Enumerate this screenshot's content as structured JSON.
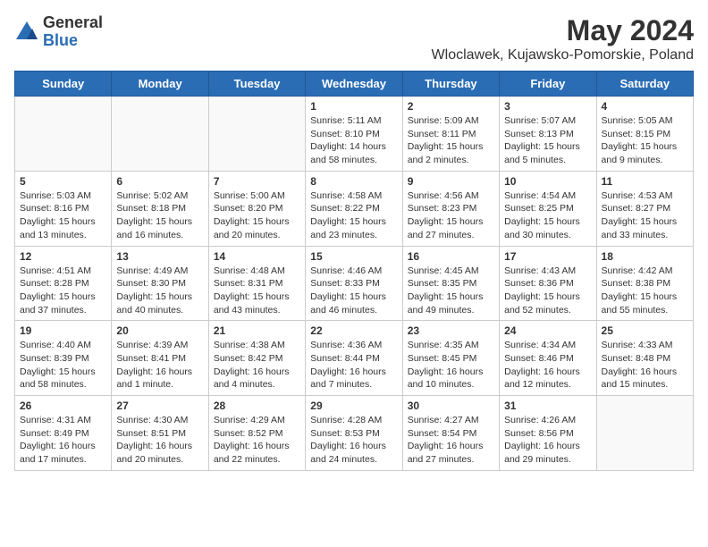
{
  "logo": {
    "general": "General",
    "blue": "Blue"
  },
  "title": "May 2024",
  "subtitle": "Wloclawek, Kujawsko-Pomorskie, Poland",
  "headers": [
    "Sunday",
    "Monday",
    "Tuesday",
    "Wednesday",
    "Thursday",
    "Friday",
    "Saturday"
  ],
  "weeks": [
    [
      {
        "day": "",
        "info": ""
      },
      {
        "day": "",
        "info": ""
      },
      {
        "day": "",
        "info": ""
      },
      {
        "day": "1",
        "info": "Sunrise: 5:11 AM\nSunset: 8:10 PM\nDaylight: 14 hours\nand 58 minutes."
      },
      {
        "day": "2",
        "info": "Sunrise: 5:09 AM\nSunset: 8:11 PM\nDaylight: 15 hours\nand 2 minutes."
      },
      {
        "day": "3",
        "info": "Sunrise: 5:07 AM\nSunset: 8:13 PM\nDaylight: 15 hours\nand 5 minutes."
      },
      {
        "day": "4",
        "info": "Sunrise: 5:05 AM\nSunset: 8:15 PM\nDaylight: 15 hours\nand 9 minutes."
      }
    ],
    [
      {
        "day": "5",
        "info": "Sunrise: 5:03 AM\nSunset: 8:16 PM\nDaylight: 15 hours\nand 13 minutes."
      },
      {
        "day": "6",
        "info": "Sunrise: 5:02 AM\nSunset: 8:18 PM\nDaylight: 15 hours\nand 16 minutes."
      },
      {
        "day": "7",
        "info": "Sunrise: 5:00 AM\nSunset: 8:20 PM\nDaylight: 15 hours\nand 20 minutes."
      },
      {
        "day": "8",
        "info": "Sunrise: 4:58 AM\nSunset: 8:22 PM\nDaylight: 15 hours\nand 23 minutes."
      },
      {
        "day": "9",
        "info": "Sunrise: 4:56 AM\nSunset: 8:23 PM\nDaylight: 15 hours\nand 27 minutes."
      },
      {
        "day": "10",
        "info": "Sunrise: 4:54 AM\nSunset: 8:25 PM\nDaylight: 15 hours\nand 30 minutes."
      },
      {
        "day": "11",
        "info": "Sunrise: 4:53 AM\nSunset: 8:27 PM\nDaylight: 15 hours\nand 33 minutes."
      }
    ],
    [
      {
        "day": "12",
        "info": "Sunrise: 4:51 AM\nSunset: 8:28 PM\nDaylight: 15 hours\nand 37 minutes."
      },
      {
        "day": "13",
        "info": "Sunrise: 4:49 AM\nSunset: 8:30 PM\nDaylight: 15 hours\nand 40 minutes."
      },
      {
        "day": "14",
        "info": "Sunrise: 4:48 AM\nSunset: 8:31 PM\nDaylight: 15 hours\nand 43 minutes."
      },
      {
        "day": "15",
        "info": "Sunrise: 4:46 AM\nSunset: 8:33 PM\nDaylight: 15 hours\nand 46 minutes."
      },
      {
        "day": "16",
        "info": "Sunrise: 4:45 AM\nSunset: 8:35 PM\nDaylight: 15 hours\nand 49 minutes."
      },
      {
        "day": "17",
        "info": "Sunrise: 4:43 AM\nSunset: 8:36 PM\nDaylight: 15 hours\nand 52 minutes."
      },
      {
        "day": "18",
        "info": "Sunrise: 4:42 AM\nSunset: 8:38 PM\nDaylight: 15 hours\nand 55 minutes."
      }
    ],
    [
      {
        "day": "19",
        "info": "Sunrise: 4:40 AM\nSunset: 8:39 PM\nDaylight: 15 hours\nand 58 minutes."
      },
      {
        "day": "20",
        "info": "Sunrise: 4:39 AM\nSunset: 8:41 PM\nDaylight: 16 hours\nand 1 minute."
      },
      {
        "day": "21",
        "info": "Sunrise: 4:38 AM\nSunset: 8:42 PM\nDaylight: 16 hours\nand 4 minutes."
      },
      {
        "day": "22",
        "info": "Sunrise: 4:36 AM\nSunset: 8:44 PM\nDaylight: 16 hours\nand 7 minutes."
      },
      {
        "day": "23",
        "info": "Sunrise: 4:35 AM\nSunset: 8:45 PM\nDaylight: 16 hours\nand 10 minutes."
      },
      {
        "day": "24",
        "info": "Sunrise: 4:34 AM\nSunset: 8:46 PM\nDaylight: 16 hours\nand 12 minutes."
      },
      {
        "day": "25",
        "info": "Sunrise: 4:33 AM\nSunset: 8:48 PM\nDaylight: 16 hours\nand 15 minutes."
      }
    ],
    [
      {
        "day": "26",
        "info": "Sunrise: 4:31 AM\nSunset: 8:49 PM\nDaylight: 16 hours\nand 17 minutes."
      },
      {
        "day": "27",
        "info": "Sunrise: 4:30 AM\nSunset: 8:51 PM\nDaylight: 16 hours\nand 20 minutes."
      },
      {
        "day": "28",
        "info": "Sunrise: 4:29 AM\nSunset: 8:52 PM\nDaylight: 16 hours\nand 22 minutes."
      },
      {
        "day": "29",
        "info": "Sunrise: 4:28 AM\nSunset: 8:53 PM\nDaylight: 16 hours\nand 24 minutes."
      },
      {
        "day": "30",
        "info": "Sunrise: 4:27 AM\nSunset: 8:54 PM\nDaylight: 16 hours\nand 27 minutes."
      },
      {
        "day": "31",
        "info": "Sunrise: 4:26 AM\nSunset: 8:56 PM\nDaylight: 16 hours\nand 29 minutes."
      },
      {
        "day": "",
        "info": ""
      }
    ]
  ]
}
